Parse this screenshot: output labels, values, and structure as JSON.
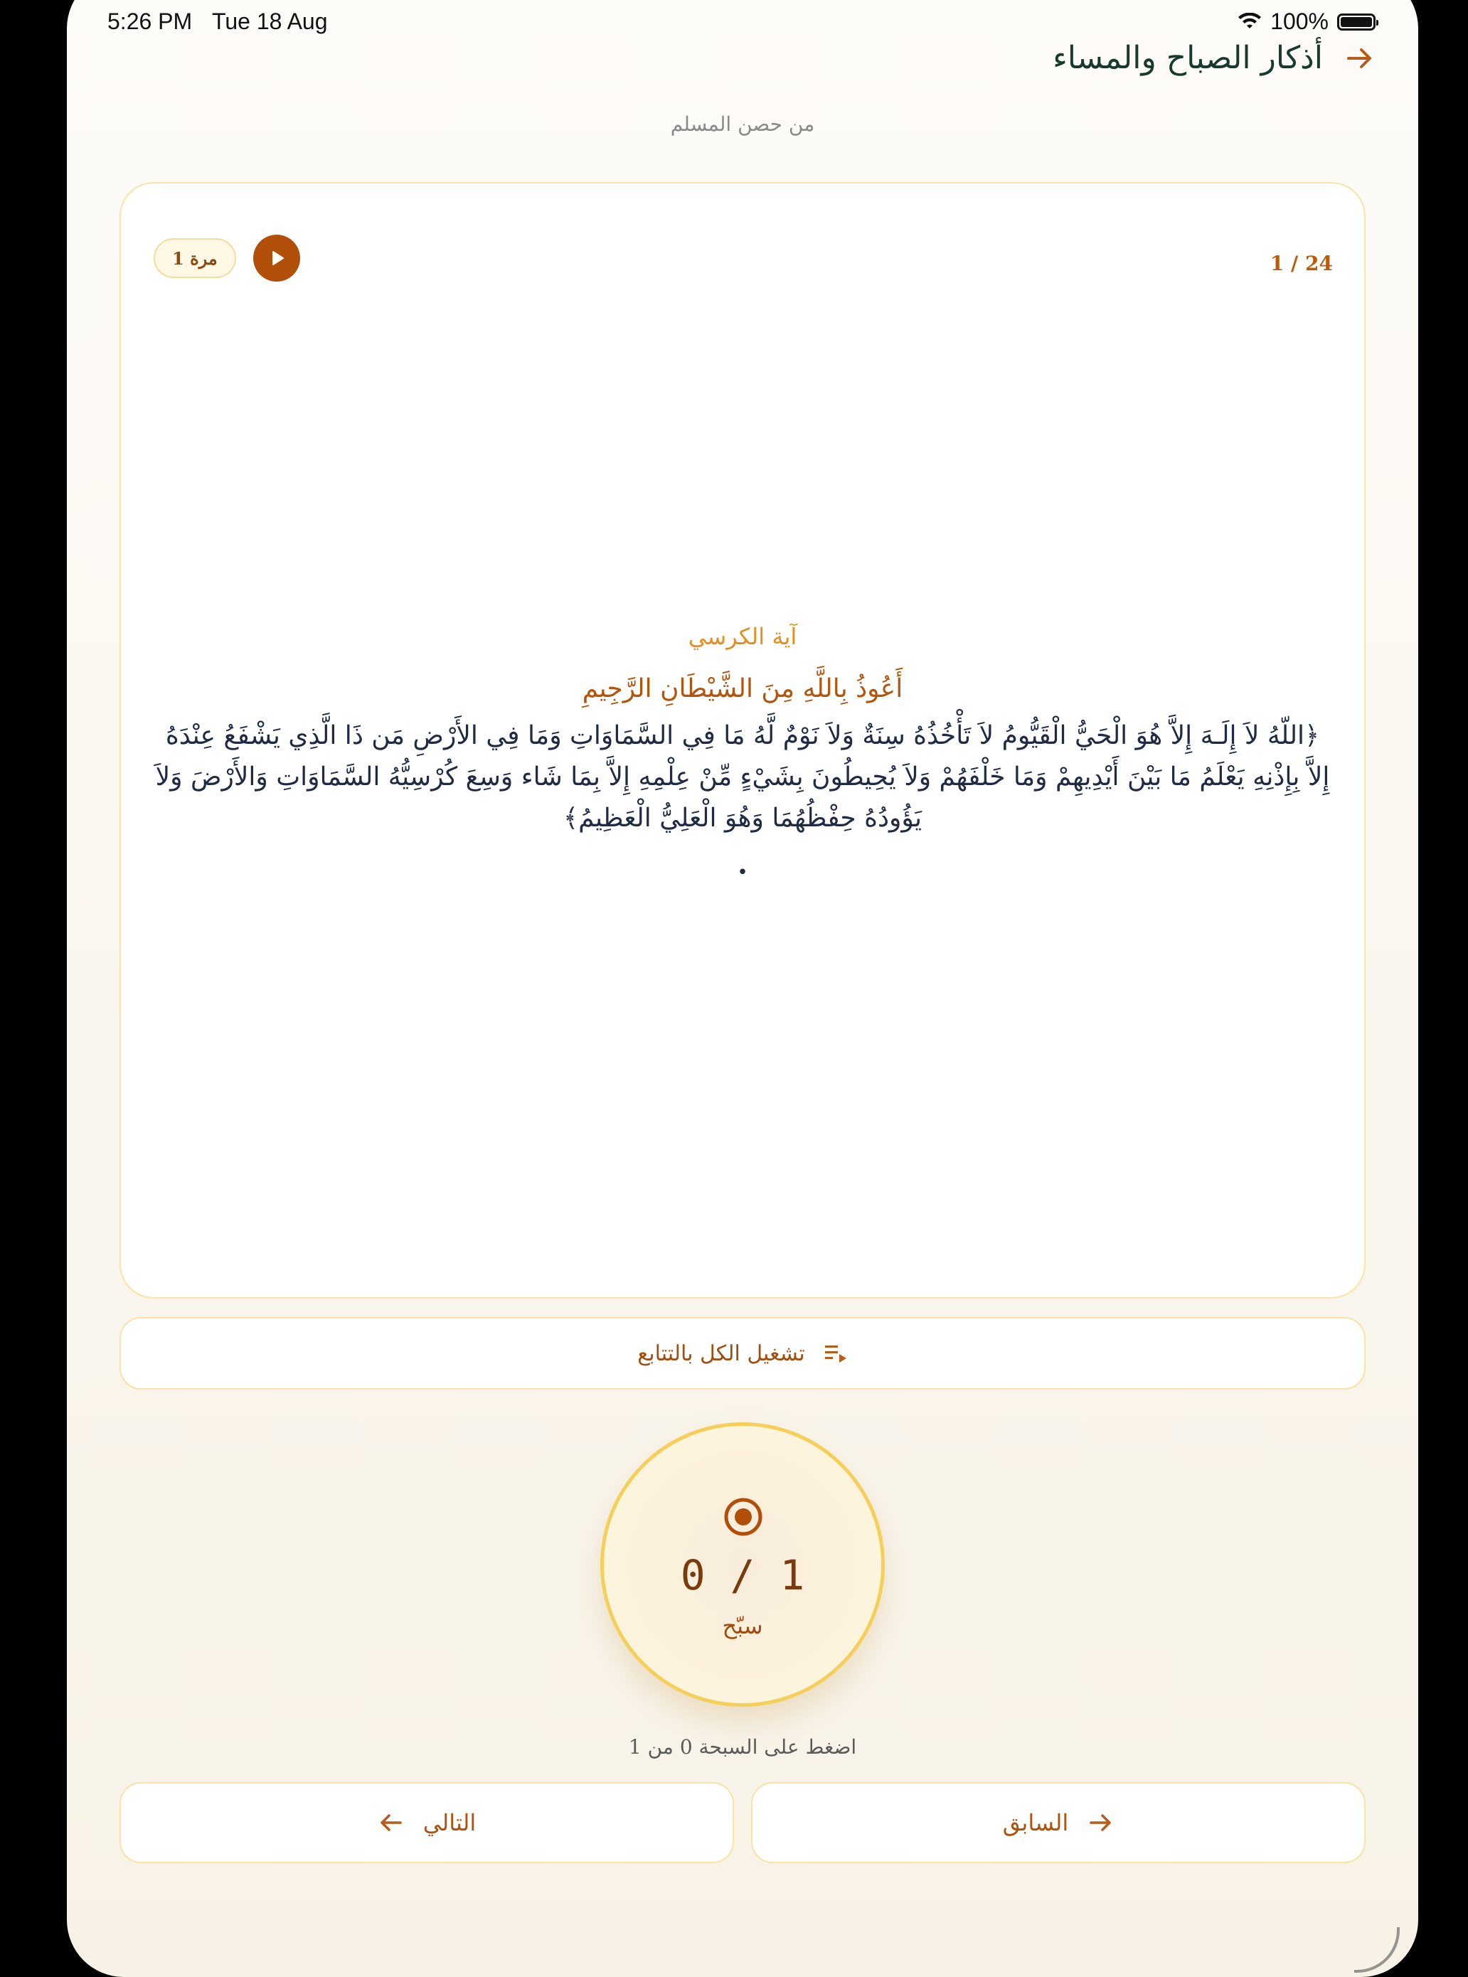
{
  "status_bar": {
    "time": "5:26 PM",
    "date": "Tue 18 Aug",
    "battery": "100%"
  },
  "header": {
    "title": "أذكار الصباح والمساء",
    "source": "من حصن المسلم"
  },
  "card": {
    "progress": "1 / 24",
    "repeat_badge": "1 مرة",
    "dhikr_title": "آية الكرسي",
    "isti_adha": "أَعُوذُ بِاللَّهِ مِنَ الشَّيْطَانِ الرَّجِيمِ",
    "ayah": "﴿اللّهُ لاَ إِلَـهَ إِلاَّ هُوَ الْحَيُّ الْقَيُّومُ لاَ تَأْخُذُهُ سِنَةٌ وَلاَ نَوْمٌ لَّهُ مَا فِي السَّمَاوَاتِ وَمَا فِي الأَرْضِ مَن ذَا الَّذِي يَشْفَعُ عِنْدَهُ إِلاَّ بِإِذْنِهِ يَعْلَمُ مَا بَيْنَ أَيْدِيهِمْ وَمَا خَلْفَهُمْ وَلاَ يُحِيطُونَ بِشَيْءٍ مِّنْ عِلْمِهِ إِلاَّ بِمَا شَاء وَسِعَ كُرْسِيُّهُ السَّمَاوَاتِ وَالأَرْضَ وَلاَ يَؤُودُهُ حِفْظُهُمَا وَهُوَ الْعَلِيُّ الْعَظِيمُ﴾",
    "dot": "•"
  },
  "play_all": {
    "label": "تشغيل الكل بالتتابع"
  },
  "tasbih": {
    "count": "0 / 1",
    "label": "سبّح"
  },
  "hint": "اضغط على السبحة 0 من 1",
  "nav": {
    "next": "التالي",
    "previous": "السابق"
  },
  "colors": {
    "accent": "#b14f09",
    "border": "#fae3a6",
    "title": "#173a2e",
    "gold": "#f5cf5a"
  },
  "icons": [
    "back-arrow-icon",
    "play-icon",
    "playlist-icon",
    "target-icon",
    "arrow-left-icon",
    "arrow-right-icon",
    "wifi-icon",
    "battery-icon"
  ]
}
